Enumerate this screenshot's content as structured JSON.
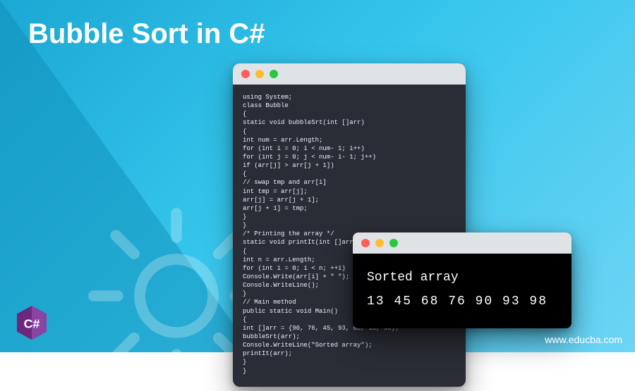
{
  "title": "Bubble Sort in C#",
  "watermark": "www.educba.com",
  "colors": {
    "bg1": "#1ba8d4",
    "bg2": "#6dd5f5",
    "window": "#2b2d36"
  },
  "code_window": {
    "code": "using System;\nclass Bubble\n{\nstatic void bubbleSrt(int []arr)\n{\nint num = arr.Length;\nfor (int i = 0; i < num- 1; i++)\nfor (int j = 0; j < num- i- 1; j++)\nif (arr[j] > arr[j + 1])\n{\n// swap tmp and arr[i]\nint tmp = arr[j];\narr[j] = arr[j + 1];\narr[j + 1] = tmp;\n}\n}\n/* Printing the array */\nstatic void printIt(int []arr)\n{\nint n = arr.Length;\nfor (int i = 0; i < n; ++i)\nConsole.Write(arr[i] + \" \");\nConsole.WriteLine();\n}\n// Main method\npublic static void Main()\n{\nint []arr = {90, 76, 45, 93, 68, 13, 98};\nbubbleSrt(arr);\nConsole.WriteLine(\"Sorted array\");\nprintIt(arr);\n}\n}"
  },
  "output_window": {
    "heading": "Sorted array",
    "values": "13  45  68  76  90  93  98"
  },
  "logo": {
    "label": "C#",
    "color": "#6d287e"
  }
}
